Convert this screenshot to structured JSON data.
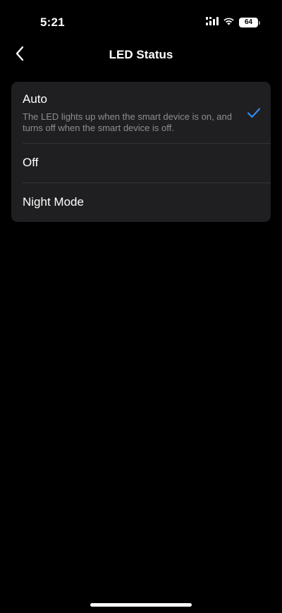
{
  "status_bar": {
    "time": "5:21",
    "battery_level": "64",
    "signal_icon": "cellular-signal-icon",
    "wifi_icon": "wifi-icon"
  },
  "nav": {
    "back_icon": "chevron-left-icon",
    "title": "LED Status"
  },
  "options": [
    {
      "label": "Auto",
      "description": "The LED lights up when the smart device is on, and turns off when the smart device is off.",
      "selected": true
    },
    {
      "label": "Off",
      "selected": false
    },
    {
      "label": "Night Mode",
      "selected": false
    }
  ],
  "colors": {
    "background": "#000000",
    "card": "#1f1f21",
    "accent": "#2f8cf0",
    "secondary_text": "#8e8e93"
  }
}
